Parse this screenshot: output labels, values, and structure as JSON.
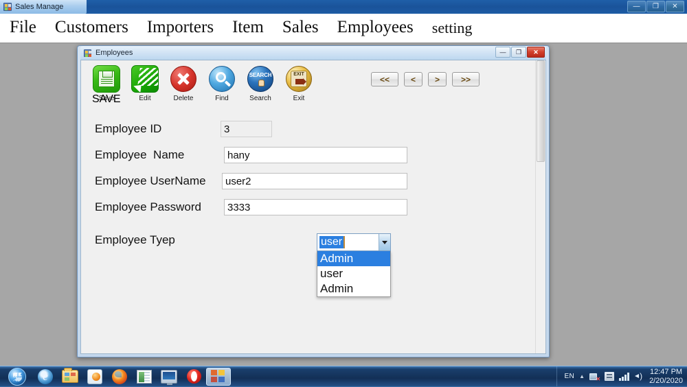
{
  "main_window": {
    "title": "Sales Manage",
    "icon": "visual-studio-form-icon",
    "window_buttons": {
      "minimize": "—",
      "maximize": "❐",
      "close": "✕"
    }
  },
  "menubar": {
    "items": [
      {
        "label": "File"
      },
      {
        "label": "Customers"
      },
      {
        "label": "Importers"
      },
      {
        "label": "Item"
      },
      {
        "label": "Sales"
      },
      {
        "label": "Employees"
      },
      {
        "label": "setting"
      }
    ]
  },
  "child_window": {
    "title": "Employees",
    "icon": "visual-studio-form-icon",
    "window_buttons": {
      "minimize": "—",
      "maximize": "❐",
      "close": "✕"
    },
    "toolbar": {
      "buttons": [
        {
          "label": "Save",
          "icon": "save-icon",
          "wordmark": "SAVE"
        },
        {
          "label": "Edit",
          "icon": "edit-icon",
          "wordmark": ""
        },
        {
          "label": "Delete",
          "icon": "delete-icon",
          "wordmark": ""
        },
        {
          "label": "Find",
          "icon": "find-icon",
          "wordmark": ""
        },
        {
          "label": "Search",
          "icon": "search-icon",
          "wordmark": "SEARCH"
        },
        {
          "label": "Exit",
          "icon": "exit-icon",
          "wordmark": "EXIT"
        }
      ],
      "nav": [
        {
          "label": "<<",
          "name": "first-record"
        },
        {
          "label": "<",
          "name": "previous-record"
        },
        {
          "label": ">",
          "name": "next-record"
        },
        {
          "label": ">>",
          "name": "last-record"
        }
      ]
    },
    "form": {
      "fields": [
        {
          "label": "Employee ID",
          "value": "3",
          "readonly": true
        },
        {
          "label": "Employee  Name",
          "value": "hany",
          "readonly": false
        },
        {
          "label": "Employee UserName",
          "value": "user2",
          "readonly": false
        },
        {
          "label": "Employee Password",
          "value": "3333",
          "readonly": false
        }
      ],
      "combo": {
        "label": "Employee Tyep",
        "value": "user",
        "expanded": true,
        "options": [
          {
            "label": "Admin",
            "selected": true
          },
          {
            "label": "user",
            "selected": false
          },
          {
            "label": "Admin",
            "selected": false
          }
        ]
      }
    }
  },
  "taskbar": {
    "start": "start-orb",
    "items": [
      {
        "name": "internet-explorer-icon",
        "active": false
      },
      {
        "name": "file-explorer-icon",
        "active": false
      },
      {
        "name": "windows-media-player-icon",
        "active": false
      },
      {
        "name": "firefox-icon",
        "active": false
      },
      {
        "name": "spreadsheet-app-icon",
        "active": false
      },
      {
        "name": "remote-desktop-icon",
        "active": false
      },
      {
        "name": "opera-icon",
        "active": false
      },
      {
        "name": "sales-manage-app-icon",
        "active": true
      }
    ],
    "tray": {
      "language": "EN",
      "caret": "▲",
      "network_icon": "network-disconnected-icon",
      "action_center_icon": "action-center-icon",
      "signal_icon": "signal-bars-icon",
      "volume_icon": "volume-icon",
      "time": "12:47 PM",
      "date": "2/20/2020"
    }
  },
  "colors": {
    "accent_blue": "#2b7fe0",
    "taskbar_blue": "#102c52",
    "mdi_gray": "#a6a6a6",
    "form_gray": "#f0f0f0",
    "save_green": "#37b915",
    "delete_red": "#d5332a",
    "exit_gold": "#e9bd45"
  }
}
